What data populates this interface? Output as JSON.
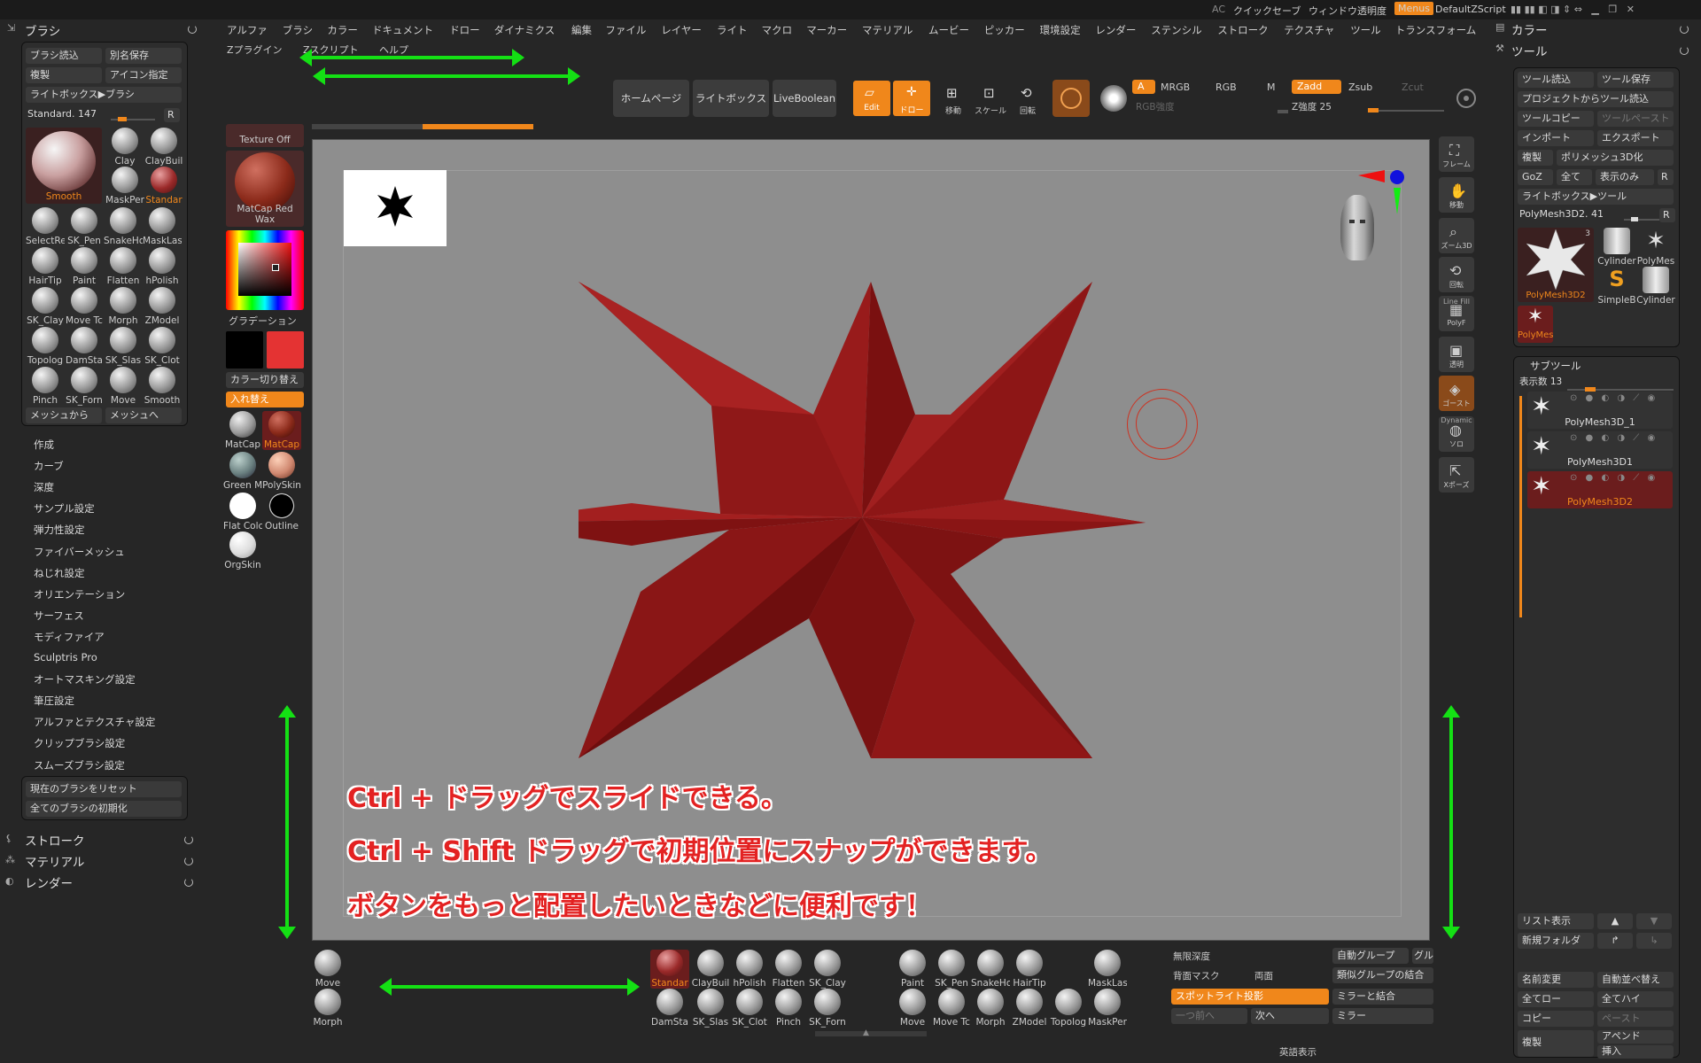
{
  "titlebar": {
    "ac": "AC",
    "quicksave": "クイックセーブ",
    "window_opacity": "ウィンドウ透明度",
    "menus": "Menus",
    "script": "DefaultZScript"
  },
  "topmenu": {
    "row1": [
      "アルファ",
      "ブラシ",
      "カラー",
      "ドキュメント",
      "ドロー",
      "ダイナミクス",
      "編集",
      "ファイル",
      "レイヤー",
      "ライト",
      "マクロ",
      "マーカー",
      "マテリアル",
      "ムービー",
      "ピッカー",
      "環境設定",
      "レンダー",
      "ステンシル",
      "ストローク",
      "テクスチャ",
      "ツール",
      "トランスフォーム"
    ],
    "row2": [
      "Zプラグイン",
      "Zスクリプト",
      "ヘルプ"
    ]
  },
  "toolbar": {
    "homepage": "ホームページ",
    "lightbox": "ライトボックス",
    "liveboolean": "LiveBoolean",
    "edit": "Edit",
    "draw": "ドロー",
    "move": "移動",
    "scale": "スケール",
    "rotate": "回転",
    "a": "A",
    "mrgb": "MRGB",
    "rgb": "RGB",
    "m": "M",
    "zadd": "Zadd",
    "zsub": "Zsub",
    "zcut": "Zcut",
    "rgb_intensity": "RGB強度",
    "z_intensity": "Z強度 25"
  },
  "brush_panel": {
    "title": "ブラシ",
    "load": "ブラシ読込",
    "save_as": "別名保存",
    "clone": "複製",
    "icon": "アイコン指定",
    "lightbox": "ライトボックス▶ブラシ",
    "standard_count": "Standard. 147",
    "r": "R",
    "big": "Smooth",
    "grid": [
      "Clay",
      "ClayBuil",
      "MaskPer",
      "Standar",
      "SelectRe",
      "SK_Pen",
      "SnakeHo",
      "MaskLas",
      "HairTip",
      "Paint",
      "Flatten",
      "hPolish",
      "SK_Clay",
      "Move Tc",
      "Morph",
      "ZModel",
      "Topolog",
      "DamSta",
      "SK_Slas",
      "SK_Clot",
      "Pinch",
      "SK_Forn",
      "Move",
      "Smooth"
    ],
    "from_mesh": "メッシュから",
    "to_mesh": "メッシュへ",
    "sections": [
      "作成",
      "カーブ",
      "深度",
      "サンプル設定",
      "弾力性設定",
      "ファイバーメッシュ",
      "ねじれ設定",
      "オリエンテーション",
      "サーフェス",
      "モディファイア",
      "Sculptris Pro",
      "オートマスキング設定",
      "筆圧設定",
      "アルファとテクスチャ設定",
      "クリップブラシ設定",
      "スムーズブラシ設定"
    ],
    "reset_current": "現在のブラシをリセット",
    "reset_all": "全てのブラシの初期化"
  },
  "bottom_left_menu": [
    "ストローク",
    "マテリアル",
    "レンダー"
  ],
  "left_shelf": {
    "texture": "Texture Off",
    "matcap": "MatCap Red Wax",
    "gradation": "グラデーション",
    "switch": "カラー切り替え",
    "swap": "入れ替え",
    "materials": [
      "MatCap",
      "MatCap",
      "Green M",
      "PolySkin",
      "Flat Colc",
      "Outline",
      "OrgSkin"
    ]
  },
  "right_shelf": [
    "フレーム",
    "移動",
    "ズーム3D",
    "回転",
    "PolyF",
    "透明",
    "ゴースト",
    "ソロ",
    "Xポーズ"
  ],
  "right_shelf_labels": {
    "linefill": "Line Fill",
    "dynamic": "Dynamic"
  },
  "right_panel": {
    "color": "カラー",
    "tool": "ツール",
    "tool_load": "ツール読込",
    "tool_save": "ツール保存",
    "project_load": "プロジェクトからツール読込",
    "tool_copy": "ツールコピー",
    "tool_paste": "ツールペースト",
    "import": "インポート",
    "export": "エクスポート",
    "clone": "複製",
    "polymesh3d": "ポリメッシュ3D化",
    "goz": "GoZ",
    "all": "全て",
    "display_only": "表示のみ",
    "r": "R",
    "lightbox_tool": "ライトボックス▶ツール",
    "polymesh_count": "PolyMesh3D2. 41",
    "tool_thumbs": [
      "PolyMesh3D2",
      "Cylinder",
      "PolyMes",
      "SimpleB",
      "Cylinder",
      "PolyMes"
    ],
    "tool_thumb_badge": "3",
    "subtool": "サブツール",
    "display_count": "表示数 13",
    "subtools": [
      "PolyMesh3D_1",
      "PolyMesh3D1",
      "PolyMesh3D2"
    ],
    "list_view": "リスト表示",
    "new_folder": "新規フォルダ",
    "rename": "名前変更",
    "auto_sort": "自動並べ替え",
    "all_low": "全てロー",
    "all_high": "全てハイ",
    "copy": "コピー",
    "paste": "ペースト",
    "duplicate": "複製",
    "append": "アペンド",
    "insert": "挿入"
  },
  "bottom_shelf": {
    "left": [
      "Move",
      "Morph"
    ],
    "brushes_row1": [
      "Standar",
      "ClayBuil",
      "hPolish",
      "Flatten",
      "SK_Clay",
      "Paint",
      "SK_Pen",
      "SnakeHo",
      "HairTip",
      "MaskLas"
    ],
    "brushes_row2": [
      "DamSta",
      "SK_Slas",
      "SK_Clot",
      "Pinch",
      "SK_Forn",
      "Move",
      "Move Tc",
      "Morph",
      "ZModel",
      "Topolog",
      "MaskPer"
    ],
    "infinite_depth": "無限深度",
    "backface_mask": "背面マスク",
    "double": "両面",
    "auto_group": "自動グループ",
    "gru": "グル",
    "merge_similar": "類似グループの結合",
    "spotlight": "スポットライト投影",
    "mirror_merge": "ミラーと結合",
    "prev": "一つ前へ",
    "next": "次へ",
    "mirror": "ミラー",
    "eng": "英語表示"
  },
  "annotations": [
    "Ctrl + ドラッグでスライドできる。",
    "Ctrl +  Shift  ドラッグで初期位置にスナップができます。",
    "ボタンをもっと配置したいときなどに便利です！"
  ],
  "colors": {
    "accent": "#f0871b",
    "star": "#8b1414",
    "arrow": "#14e014",
    "annotation": "#e32222"
  }
}
